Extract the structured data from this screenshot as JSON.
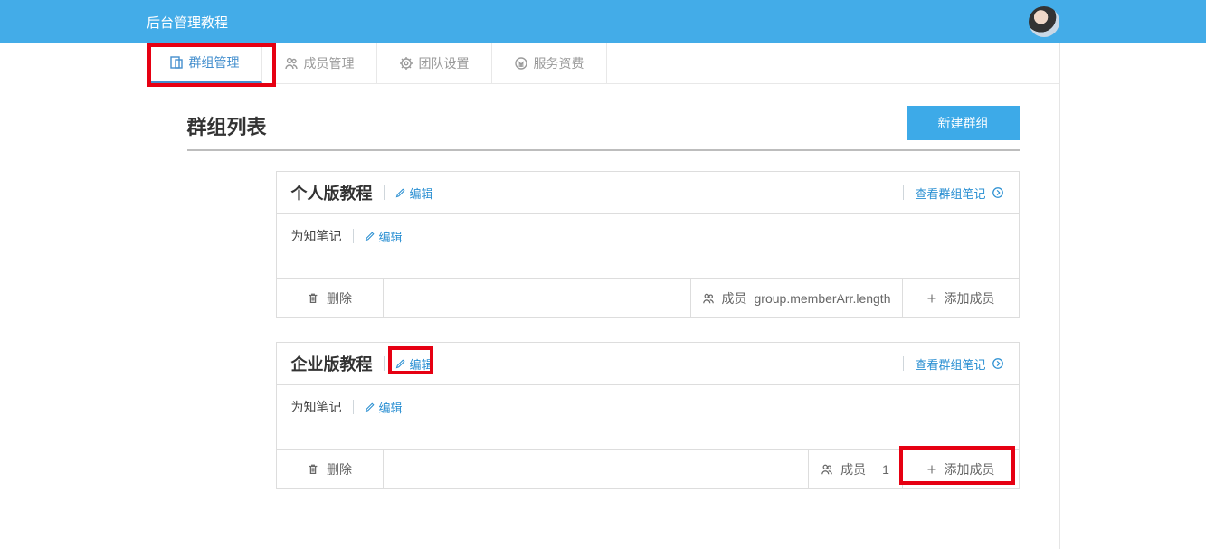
{
  "topbar": {
    "title": "后台管理教程"
  },
  "tabs": [
    {
      "label": "群组管理",
      "icon": "groups-icon",
      "active": true
    },
    {
      "label": "成员管理",
      "icon": "members-icon",
      "active": false
    },
    {
      "label": "团队设置",
      "icon": "settings-icon",
      "active": false
    },
    {
      "label": "服务资费",
      "icon": "billing-icon",
      "active": false
    }
  ],
  "main": {
    "title": "群组列表",
    "new_group_button": "新建群组"
  },
  "labels": {
    "edit": "编辑",
    "view_notes": "查看群组笔记",
    "delete": "删除",
    "members_prefix": "成员",
    "add_member": "添加成员"
  },
  "groups": [
    {
      "name": "个人版教程",
      "sub_name": "为知笔记",
      "member_count_text": "group.memberArr.length"
    },
    {
      "name": "企业版教程",
      "sub_name": "为知笔记",
      "member_count_text": "1"
    }
  ]
}
